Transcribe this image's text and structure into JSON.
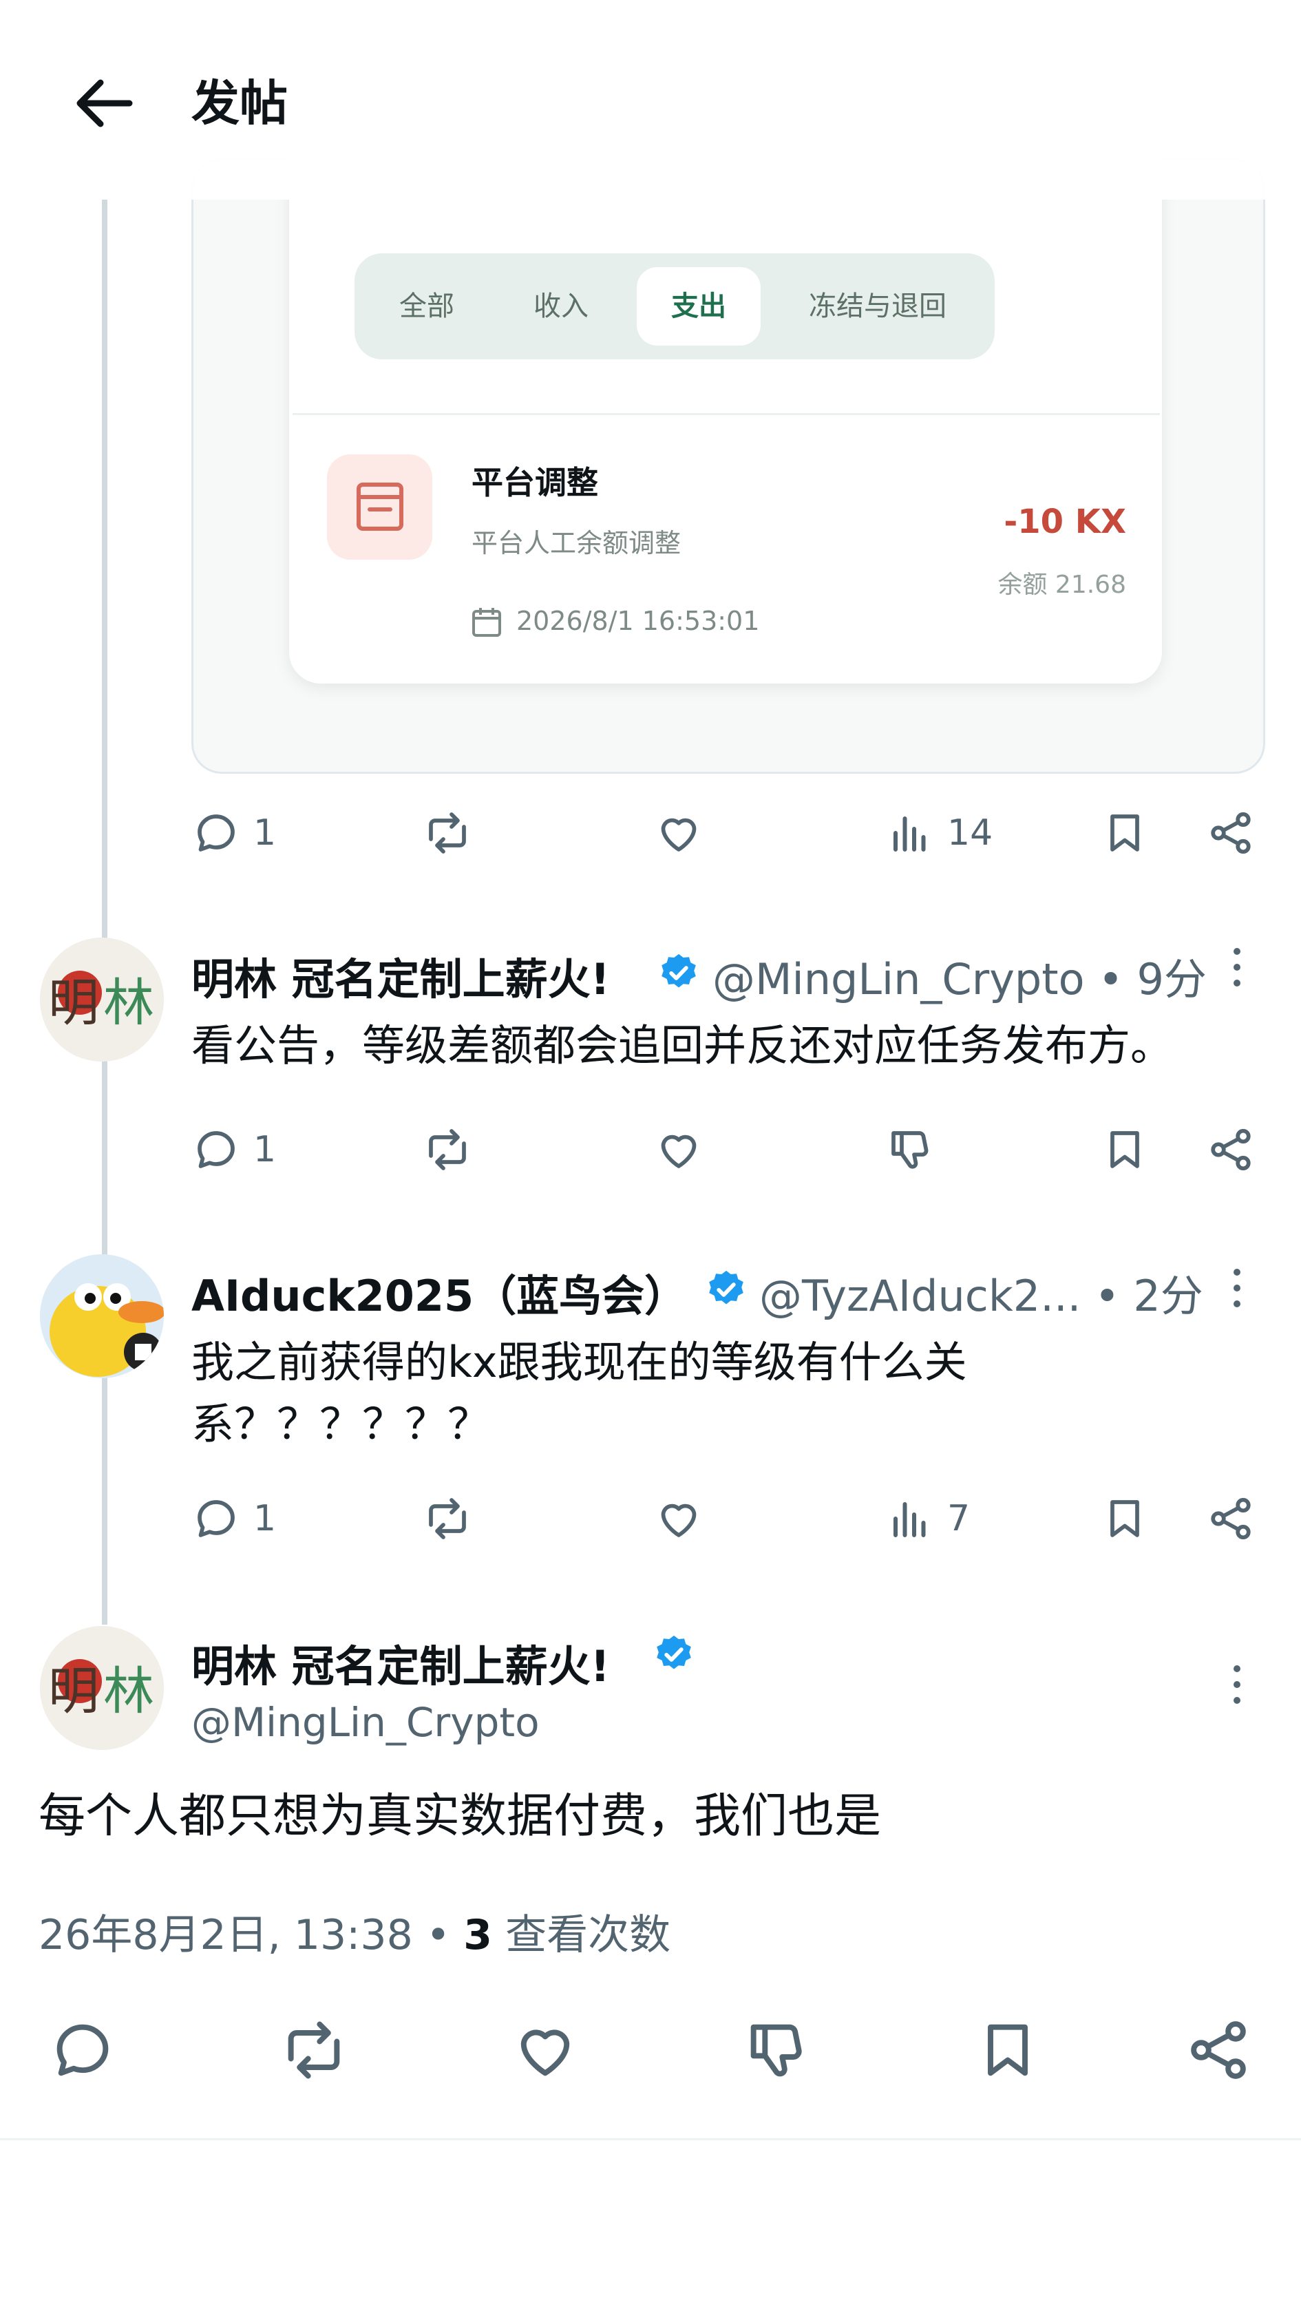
{
  "header": {
    "title": "发帖",
    "back_icon": "arrow-left-icon"
  },
  "media": {
    "tabs": [
      "全部",
      "收入",
      "支出",
      "冻结与退回"
    ],
    "active_tab": "支出",
    "record": {
      "title": "平台调整",
      "subtitle": "平台人工余额调整",
      "amount": "-10 KX",
      "balance": "余额 21.68",
      "datetime": "2026/8/1 16:53:01"
    }
  },
  "post_actions": {
    "replies": "1",
    "views": "14"
  },
  "reply1": {
    "name": "明林 冠名定制上薪火!",
    "handle_time": "@MingLin_Crypto • 9分",
    "text": "看公告，等级差额都会追回并反还对应任务发布方。",
    "replies": "1"
  },
  "reply2": {
    "name": "AIduck2025（蓝鸟会）",
    "handle_time": "@TyzAIduck2... • 2分",
    "text_line1": "我之前获得的kx跟我现在的等级有什么关",
    "text_line2": "系？？？？？？",
    "replies": "1",
    "views": "7"
  },
  "main": {
    "name": "明林 冠名定制上薪火!",
    "handle": "@MingLin_Crypto",
    "text": "每个人都只想为真实数据付费，我们也是",
    "timestamp": "26年8月2日, 13:38 • ",
    "views_count": "3",
    "views_label": " 查看次数"
  },
  "colors": {
    "verified": "#1d9bf0",
    "amount_negative": "#c64a3c",
    "tab_active": "#1e6f4d"
  }
}
